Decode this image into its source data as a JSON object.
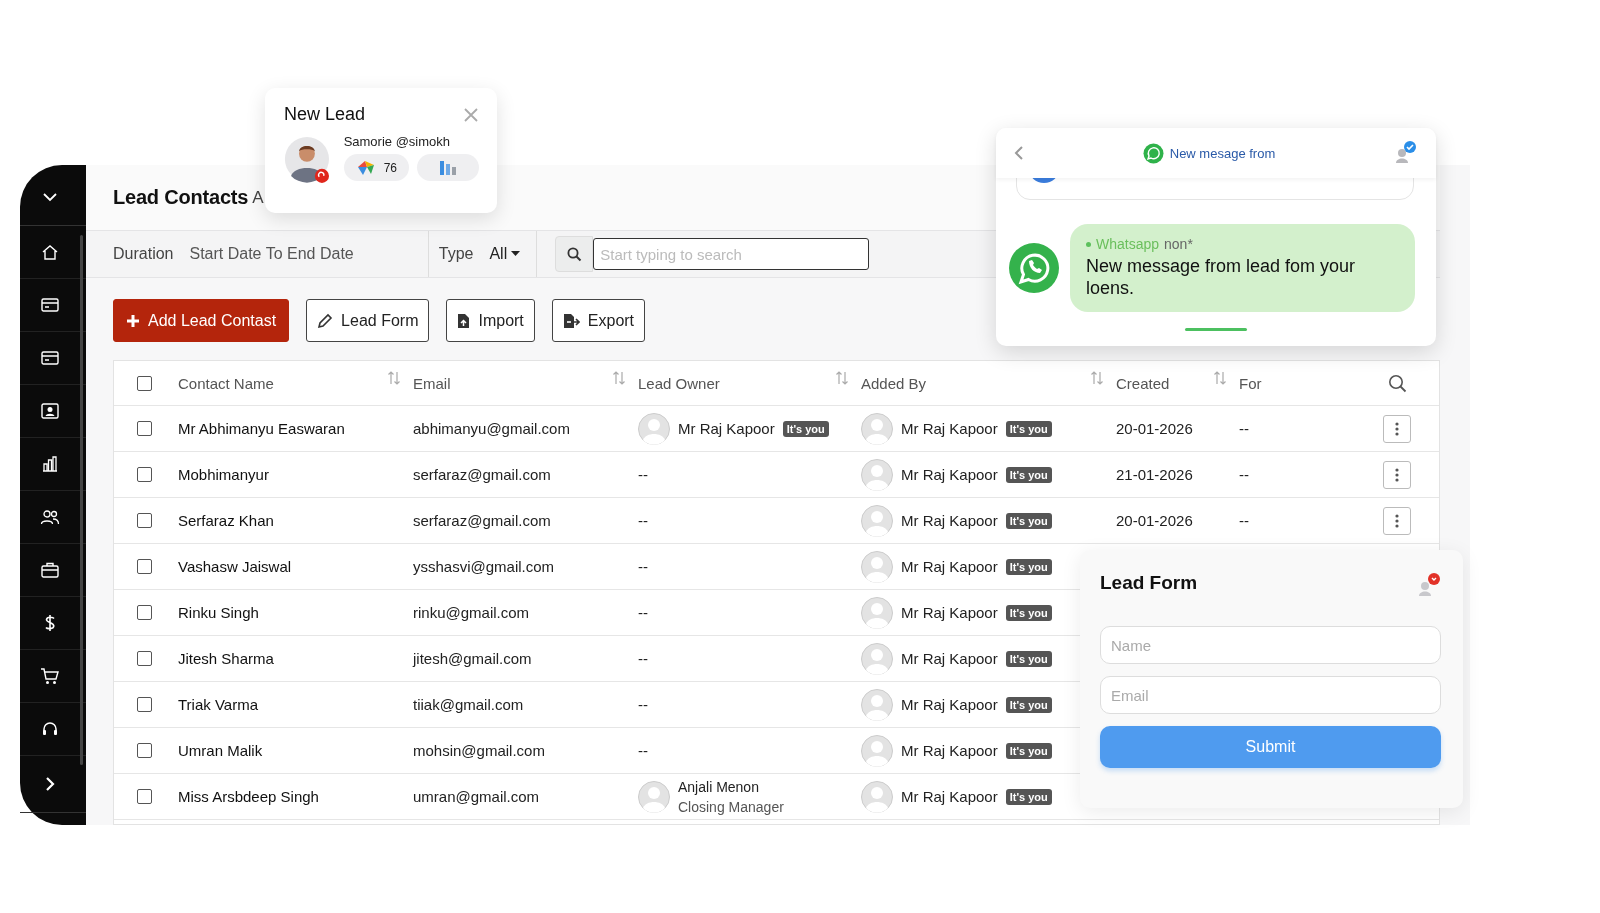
{
  "new_lead_popup": {
    "title": "New Lead",
    "contact": "Samorie @simokh",
    "score": "76"
  },
  "sidebar": {
    "items": [
      {
        "kind": "collapse"
      },
      {
        "kind": "home"
      },
      {
        "kind": "card"
      },
      {
        "kind": "card"
      },
      {
        "kind": "contact"
      },
      {
        "kind": "chart"
      },
      {
        "kind": "users"
      },
      {
        "kind": "briefcase"
      },
      {
        "kind": "dollar"
      },
      {
        "kind": "cart"
      },
      {
        "kind": "headset"
      },
      {
        "kind": "expand"
      }
    ]
  },
  "header": {
    "title": "Lead Contacts",
    "title_suffix": "A"
  },
  "filters": {
    "duration_label": "Duration",
    "duration_value": "Start Date To End Date",
    "type_label": "Type",
    "type_value": "All",
    "search": {
      "placeholder": "Start typing to search"
    }
  },
  "actions": [
    {
      "kind": "add",
      "label": "Add Lead Contast"
    },
    {
      "kind": "form",
      "label": "Lead Form"
    },
    {
      "kind": "import",
      "label": "Import"
    },
    {
      "kind": "export",
      "label": "Export"
    }
  ],
  "table": {
    "all_checked": false,
    "columns": [
      {
        "label": "Contact Name",
        "sortable": true
      },
      {
        "label": "Email",
        "sortable": true
      },
      {
        "label": "Lead Owner",
        "sortable": true
      },
      {
        "label": "Added By",
        "sortable": true
      },
      {
        "label": "Created",
        "sortable": true
      },
      {
        "label": "For",
        "sortable": false
      }
    ],
    "rows": [
      {
        "checked": false,
        "name": "Mr Abhimanyu Easwaran",
        "email": "abhimanyu@gmail.com",
        "owner": {
          "name": "Mr Raj Kapoor",
          "badge": "It's you"
        },
        "added_by": {
          "name": "Mr Raj Kapoor",
          "badge": "It's you"
        },
        "created": "20-01-2026",
        "for": "--"
      },
      {
        "checked": false,
        "name": "Mobhimanyur",
        "email": "serfaraz@gmail.com",
        "owner_text": "--",
        "added_by": {
          "name": "Mr Raj Kapoor",
          "badge": "It's you"
        },
        "created": "21-01-2026",
        "for": "--"
      },
      {
        "checked": false,
        "name": "Serfaraz Khan",
        "email": "serfaraz@gmail.com",
        "owner_text": "--",
        "added_by": {
          "name": "Mr Raj Kapoor",
          "badge": "It's you"
        },
        "created": "20-01-2026",
        "for": "--"
      },
      {
        "checked": false,
        "name": "Vashasw Jaiswal",
        "email": "ysshasvi@gmail.com",
        "owner_text": "--",
        "added_by": {
          "name": "Mr Raj Kapoor",
          "badge": "It's you"
        }
      },
      {
        "checked": false,
        "name": "Rinku Singh",
        "email": "rinku@gmail.com",
        "owner_text": "--",
        "added_by": {
          "name": "Mr Raj Kapoor",
          "badge": "It's you"
        }
      },
      {
        "checked": false,
        "name": "Jitesh Sharma",
        "email": "jitesh@gmail.com",
        "owner_text": "--",
        "added_by": {
          "name": "Mr Raj Kapoor",
          "badge": "It's you"
        }
      },
      {
        "checked": false,
        "name": "Triak Varma",
        "email": "tiiak@gmail.com",
        "owner_text": "--",
        "added_by": {
          "name": "Mr Raj Kapoor",
          "badge": "It's you"
        }
      },
      {
        "checked": false,
        "name": "Umran Malik",
        "email": "mohsin@gmail.com",
        "owner_text": "--",
        "added_by": {
          "name": "Mr Raj Kapoor",
          "badge": "It's you"
        }
      },
      {
        "checked": false,
        "name": "Miss Arsbdeep Singh",
        "email": "umran@gmail.com",
        "owner": {
          "name": "Anjali Menon",
          "role": "Closing Manager"
        },
        "added_by": {
          "name": "Mr Raj Kapoor",
          "badge": "It's you"
        }
      }
    ]
  },
  "whatsapp_popup": {
    "title": "New mesage from",
    "sender": "Whatsapp",
    "sender_suffix": "non*",
    "message": "New message from lead fom your loens."
  },
  "lead_form": {
    "title": "Lead Form",
    "fields": [
      {
        "placeholder": "Name"
      },
      {
        "placeholder": "Email"
      }
    ],
    "submit": "Submit"
  }
}
